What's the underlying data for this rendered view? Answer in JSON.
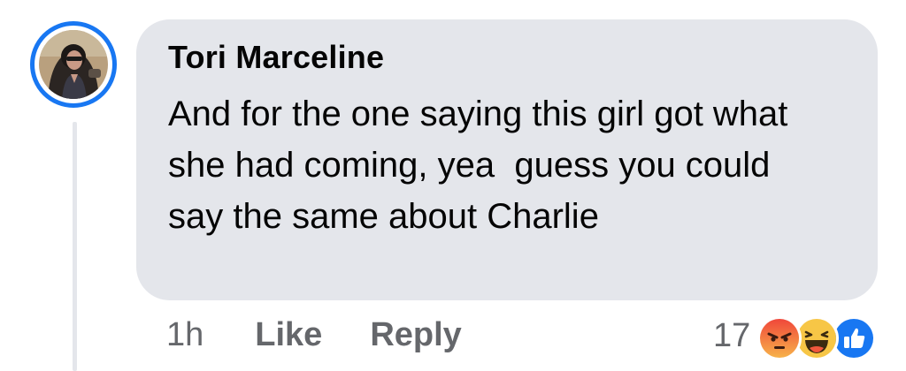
{
  "comment": {
    "author": "Tori Marceline",
    "text": "And for the one saying this girl got what she had coming, yea  guess you could say the same about Charlie",
    "timestamp": "1h",
    "like_label": "Like",
    "reply_label": "Reply",
    "reaction_count": "17",
    "reactions": [
      "angry-reaction-icon",
      "haha-reaction-icon",
      "like-reaction-icon"
    ]
  },
  "colors": {
    "bubble": "#e4e6eb",
    "avatar_ring": "#1877f2",
    "meta_text": "#65676b",
    "like_blue": "#1877f2",
    "angry_orange": "#f15a3c",
    "haha_yellow": "#f7c646"
  }
}
